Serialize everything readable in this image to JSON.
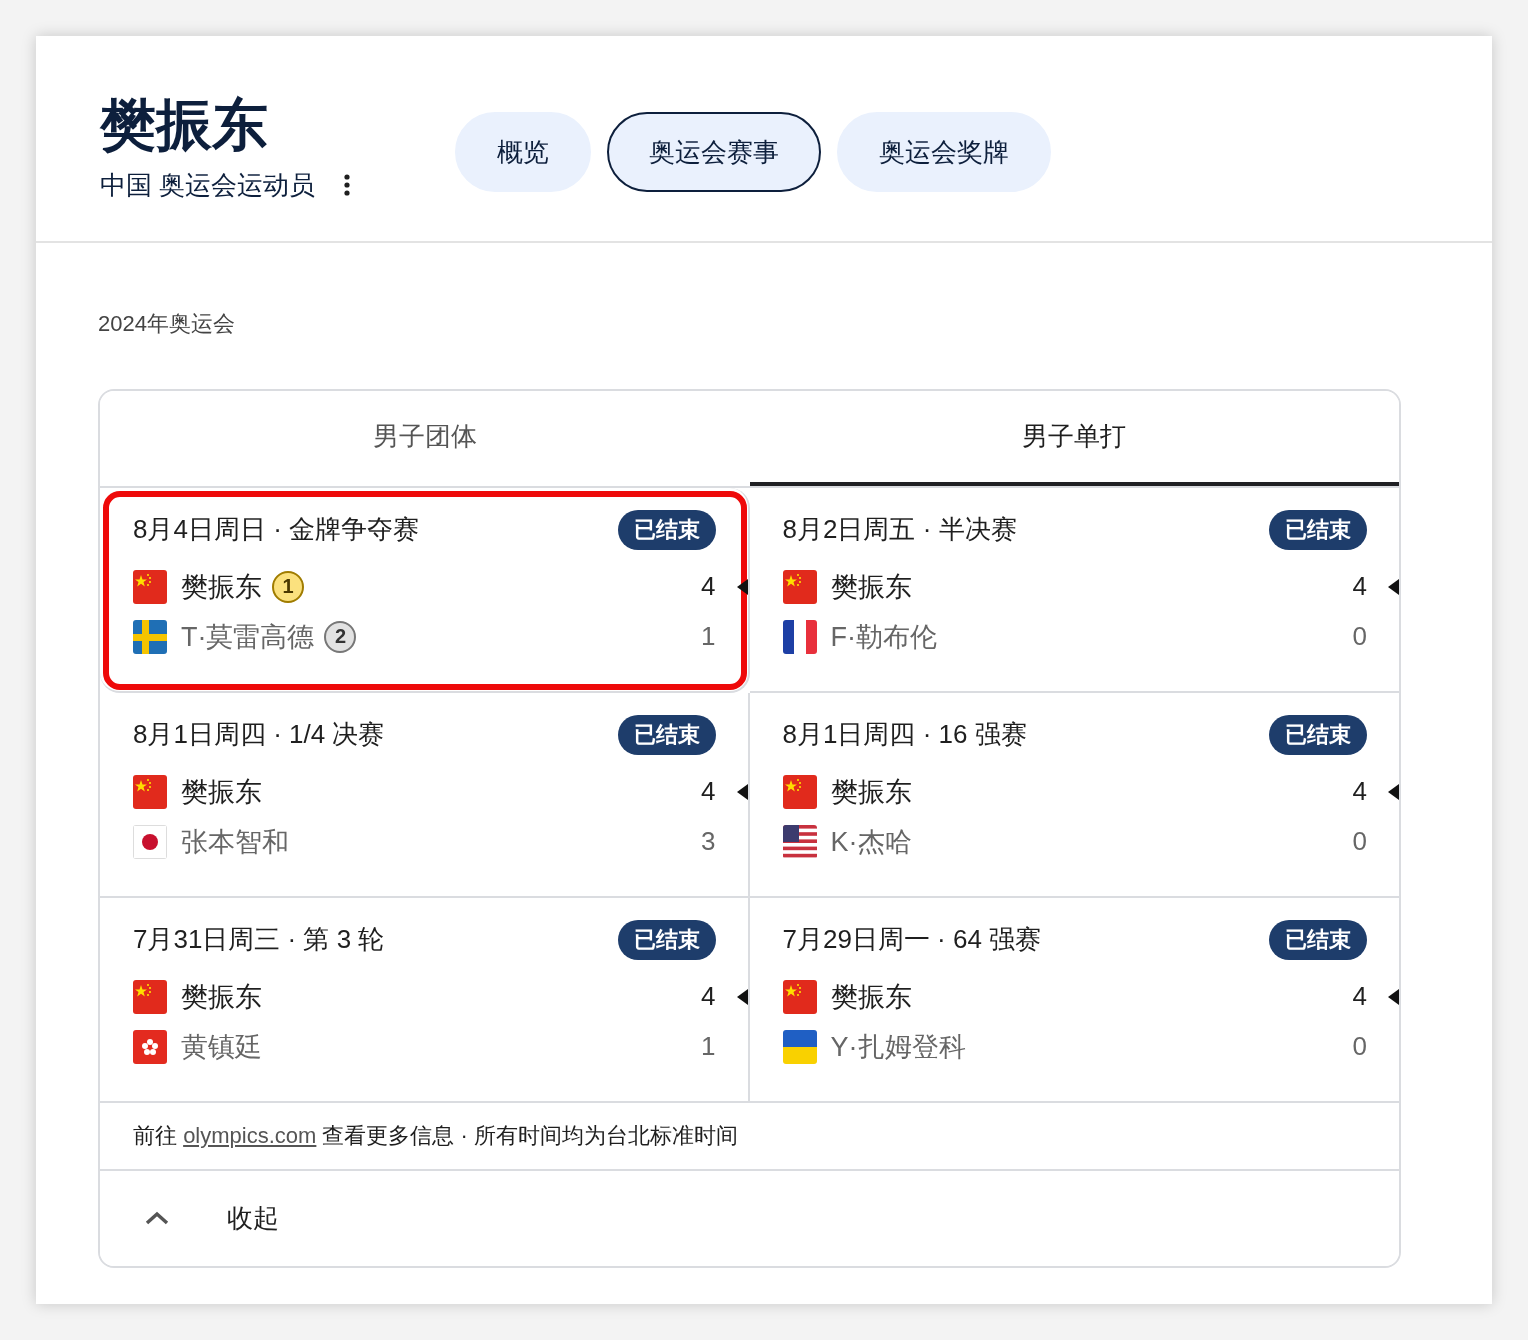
{
  "athlete": {
    "name": "樊振东",
    "subtitle": "中国 奥运会运动员"
  },
  "nav": [
    {
      "label": "概览",
      "selected": false
    },
    {
      "label": "奥运会赛事",
      "selected": true
    },
    {
      "label": "奥运会奖牌",
      "selected": false
    }
  ],
  "section_label": "2024年奥运会",
  "tabs": [
    {
      "label": "男子团体",
      "selected": false
    },
    {
      "label": "男子单打",
      "selected": true
    }
  ],
  "matches": [
    {
      "title": "8月4日周日 · 金牌争夺赛",
      "status": "已结束",
      "highlighted": true,
      "players": [
        {
          "kind": "cn",
          "name": "樊振东",
          "score": "4",
          "winner": true,
          "medal": {
            "label": "1",
            "kind": "gold"
          }
        },
        {
          "kind": "se",
          "name": "T·莫雷高德",
          "score": "1",
          "winner": false,
          "medal": {
            "label": "2",
            "kind": "silver"
          }
        }
      ]
    },
    {
      "title": "8月2日周五 · 半决赛",
      "status": "已结束",
      "highlighted": false,
      "players": [
        {
          "kind": "cn",
          "name": "樊振东",
          "score": "4",
          "winner": true
        },
        {
          "kind": "fr",
          "name": "F·勒布伦",
          "score": "0",
          "winner": false
        }
      ]
    },
    {
      "title": "8月1日周四 · 1/4 决赛",
      "status": "已结束",
      "highlighted": false,
      "players": [
        {
          "kind": "cn",
          "name": "樊振东",
          "score": "4",
          "winner": true
        },
        {
          "kind": "jp",
          "name": "张本智和",
          "score": "3",
          "winner": false
        }
      ]
    },
    {
      "title": "8月1日周四 · 16 强赛",
      "status": "已结束",
      "highlighted": false,
      "players": [
        {
          "kind": "cn",
          "name": "樊振东",
          "score": "4",
          "winner": true
        },
        {
          "kind": "us",
          "name": "K·杰哈",
          "score": "0",
          "winner": false
        }
      ]
    },
    {
      "title": "7月31日周三 · 第 3 轮",
      "status": "已结束",
      "highlighted": false,
      "players": [
        {
          "kind": "cn",
          "name": "樊振东",
          "score": "4",
          "winner": true
        },
        {
          "kind": "hk",
          "name": "黄镇廷",
          "score": "1",
          "winner": false
        }
      ]
    },
    {
      "title": "7月29日周一 · 64 强赛",
      "status": "已结束",
      "highlighted": false,
      "players": [
        {
          "kind": "cn",
          "name": "樊振东",
          "score": "4",
          "winner": true
        },
        {
          "kind": "ua",
          "name": "Y·扎姆登科",
          "score": "0",
          "winner": false
        }
      ]
    }
  ],
  "footer": {
    "before": "前往",
    "link": "olympics.com",
    "after": "查看更多信息 · 所有时间均为台北标准时间"
  },
  "collapse": {
    "label": "收起"
  }
}
